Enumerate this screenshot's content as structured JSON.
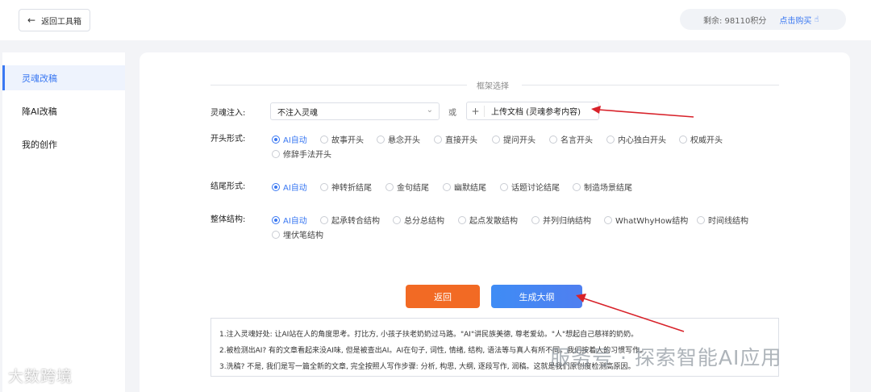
{
  "header": {
    "back_label": "返回工具箱",
    "credits_label": "剩余: 98110积分",
    "buy_label": "点击购买",
    "buy_icon": "☝"
  },
  "sidebar": {
    "items": [
      {
        "label": "灵魂改稿",
        "active": true
      },
      {
        "label": "降AI改稿",
        "active": false
      },
      {
        "label": "我的创作",
        "active": false
      }
    ]
  },
  "form": {
    "section_title": "框架选择",
    "soul": {
      "label": "灵魂注入:",
      "select_value": "不注入灵魂",
      "or_text": "或",
      "upload_label": "上传文档 (灵魂参考内容)"
    },
    "opening": {
      "label": "开头形式:",
      "options": [
        "AI自动",
        "故事开头",
        "悬念开头",
        "直接开头",
        "提问开头",
        "名言开头",
        "内心独白开头",
        "权威开头",
        "修辞手法开头"
      ],
      "selected": "AI自动"
    },
    "ending": {
      "label": "结尾形式:",
      "options": [
        "AI自动",
        "神转折结尾",
        "金句结尾",
        "幽默结尾",
        "话题讨论结尾",
        "制造场景结尾"
      ],
      "selected": "AI自动"
    },
    "structure": {
      "label": "整体结构:",
      "options": [
        "AI自动",
        "起承转合结构",
        "总分总结构",
        "起点发散结构",
        "并列归纳结构",
        "WhatWhyHow结构",
        "时间线结构",
        "埋伏笔结构"
      ],
      "selected": "AI自动"
    }
  },
  "actions": {
    "back_label": "返回",
    "generate_label": "生成大纲"
  },
  "notes": [
    "1.注入灵魂好处: 让AI站在人的角度思考。打比方, 小孩子扶老奶奶过马路。\"AI\"讲民族美德, 尊老爱幼。\"人\"想起自己慈祥的奶奶。",
    "2.被检测出AI? 有的文章看起来没AI味, 但是被查出AI。AI在句子, 词性, 情绪, 结构, 语法等与真人有所不同。我们按着人的习惯写作。",
    "3.洗稿? 不是, 我们是写一篇全新的文章, 完全按照人写作步骤: 分析, 构思, 大纲, 逐段写作, 润稿。这就是我们原创度检测高原因。"
  ],
  "watermarks": {
    "left": "大数跨境",
    "right": "服务号 · 探索智能AI应用"
  },
  "colors": {
    "accent": "#3a78f2",
    "back_button": "#f26a24",
    "annotation_arrow": "#d8222a"
  }
}
